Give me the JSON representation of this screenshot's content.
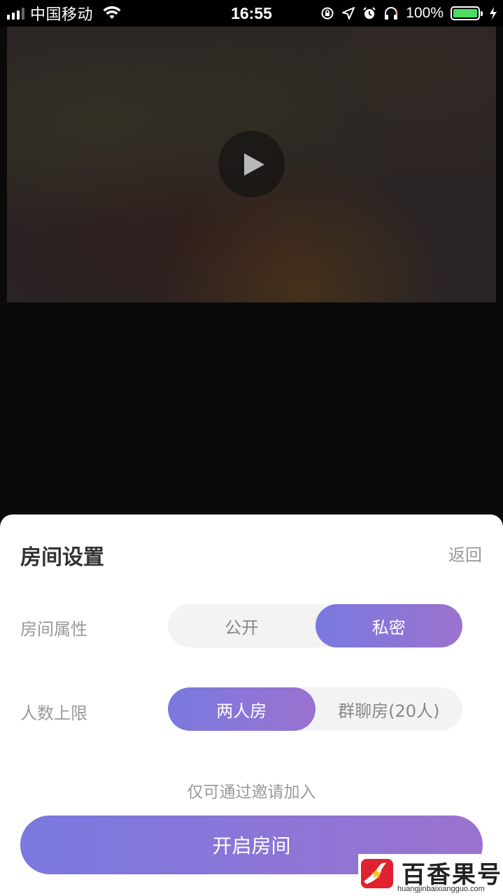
{
  "status_bar": {
    "carrier": "中国移动",
    "time": "16:55",
    "battery_percent": "100%",
    "battery_level": 1.0,
    "icons": [
      "signal-icon",
      "wifi-icon",
      "orientation-lock-icon",
      "location-icon",
      "alarm-icon",
      "headphones-icon",
      "battery-icon",
      "charging-icon"
    ]
  },
  "video": {
    "play_icon": "play-icon"
  },
  "sheet": {
    "title": "房间设置",
    "back_label": "返回",
    "room_type": {
      "label": "房间属性",
      "options": [
        "公开",
        "私密"
      ],
      "selected": "私密"
    },
    "capacity": {
      "label": "人数上限",
      "options": [
        "两人房",
        "群聊房(20人)"
      ],
      "selected": "两人房"
    },
    "hint": "仅可通过邀请加入",
    "start_label": "开启房间"
  },
  "colors": {
    "accent_start": "#7a79df",
    "accent_end": "#9b72cf",
    "battery_green": "#4cd964"
  },
  "watermark": {
    "name": "百香果号",
    "url": "huangjinbaixiangguo.com"
  }
}
